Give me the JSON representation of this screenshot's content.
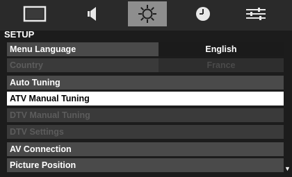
{
  "tabs": [
    {
      "name": "picture-icon",
      "active": false
    },
    {
      "name": "sound-icon",
      "active": false
    },
    {
      "name": "setup-icon",
      "active": true
    },
    {
      "name": "timer-icon",
      "active": false
    },
    {
      "name": "preferences-icon",
      "active": false
    }
  ],
  "menu": {
    "title": "SETUP",
    "items": [
      {
        "label": "Menu Language",
        "value": "English",
        "state": "normal"
      },
      {
        "label": "Country",
        "value": "France",
        "state": "disabled"
      },
      {
        "label": "Auto Tuning",
        "state": "normal"
      },
      {
        "label": "ATV Manual Tuning",
        "state": "selected"
      },
      {
        "label": "DTV Manual Tuning",
        "state": "disabled"
      },
      {
        "label": "DTV Settings",
        "state": "disabled"
      },
      {
        "label": "AV Connection",
        "state": "normal"
      },
      {
        "label": "Picture Position",
        "state": "normal"
      }
    ]
  },
  "scroll_indicator": "▼",
  "colors": {
    "background": "#1c1c1c",
    "tab_active": "#8e8e8e",
    "row_normal": "#4a4a4a",
    "row_selected": "#ffffff",
    "text_disabled": "#5c5c5c"
  }
}
